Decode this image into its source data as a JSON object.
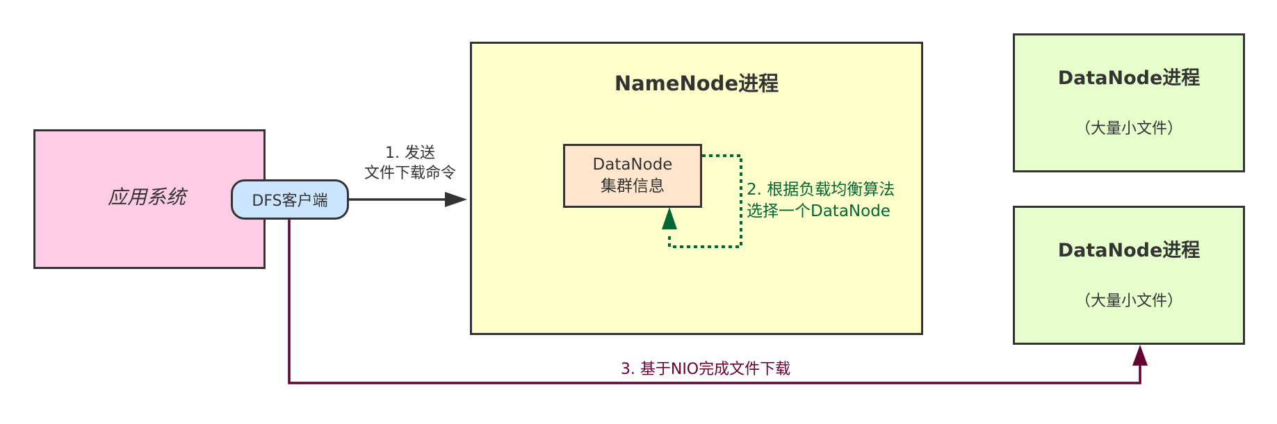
{
  "app_system": {
    "label": "应用系统"
  },
  "dfs_client": {
    "label": "DFS客户端"
  },
  "namenode": {
    "title": "NameNode进程",
    "datanode_info": {
      "line1": "DataNode",
      "line2": "集群信息"
    }
  },
  "datanodes": [
    {
      "title": "DataNode进程",
      "subtitle": "（大量小文件）"
    },
    {
      "title": "DataNode进程",
      "subtitle": "（大量小文件）"
    }
  ],
  "edges": {
    "send_command": {
      "line1": "1. 发送",
      "line2": "文件下载命令"
    },
    "select_node": {
      "line1": "2. 根据负载均衡算法",
      "line2": "选择一个DataNode"
    },
    "nio_download": {
      "label": "3. 基于NIO完成文件下载"
    }
  },
  "colors": {
    "app_fill": "#ffcce6",
    "client_fill": "#cce5ff",
    "namenode_fill": "#ffffcc",
    "info_fill": "#ffe6cc",
    "datanode_fill": "#e6ffcc",
    "select_edge": "#006633",
    "download_edge": "#660033",
    "stroke": "#333333"
  }
}
